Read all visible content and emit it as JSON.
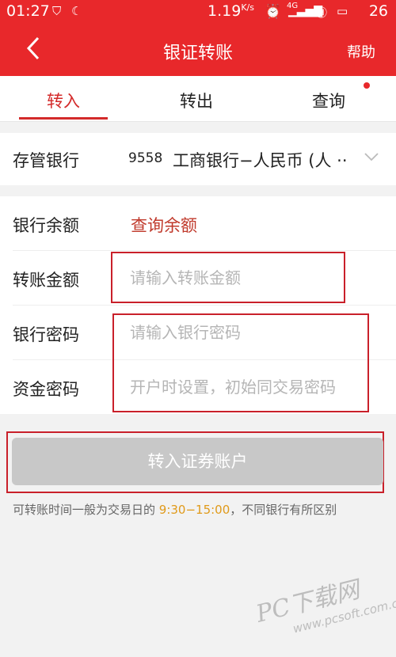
{
  "status_bar": {
    "time": "01:27",
    "speed": "1.19",
    "speed_unit": "K/s",
    "network": "4G",
    "battery": "26"
  },
  "nav": {
    "title": "银证转账",
    "help": "帮助"
  },
  "tabs": [
    {
      "label": "转入",
      "active": true
    },
    {
      "label": "转出",
      "active": false
    },
    {
      "label": "查询",
      "active": false
    }
  ],
  "bank": {
    "label": "存管银行",
    "code": "9558",
    "name": "工商银行−人民币 (人 ··"
  },
  "form": {
    "balance_label": "银行余额",
    "balance_action": "查询余额",
    "amount_label": "转账金额",
    "amount_placeholder": "请输入转账金额",
    "bank_pwd_label": "银行密码",
    "bank_pwd_placeholder": "请输入银行密码",
    "fund_pwd_label": "资金密码",
    "fund_pwd_placeholder": "开户时设置，初始同交易密码"
  },
  "submit_label": "转入证券账户",
  "hint": {
    "prefix": "可转账时间一般为交易日的 ",
    "time_range": "9:30−15:00",
    "suffix": "，不同银行有所区别"
  },
  "watermark": {
    "text": "PC下载网",
    "url": "www.pcsoft.com.cn"
  },
  "colors": {
    "brand_red": "#e8282b",
    "accent_red": "#d32a2a",
    "time_orange": "#e09a1a",
    "disabled_gray": "#c8c8c8"
  }
}
